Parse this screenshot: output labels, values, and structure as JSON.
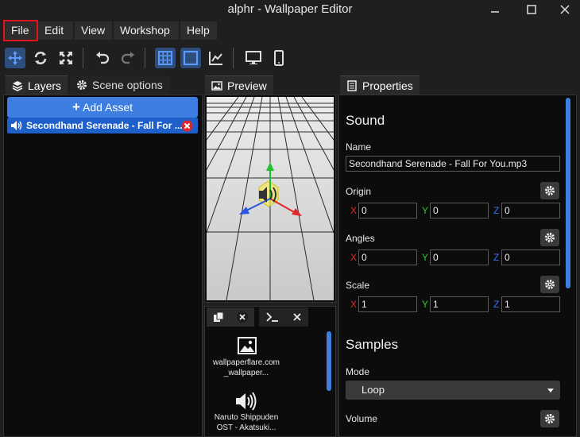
{
  "window": {
    "title": "alphr - Wallpaper Editor"
  },
  "menu": {
    "file": "File",
    "edit": "Edit",
    "view": "View",
    "workshop": "Workshop",
    "help": "Help"
  },
  "left": {
    "tab_layers": "Layers",
    "tab_scene": "Scene options",
    "add_asset": "Add Asset",
    "layer_name": "Secondhand Serenade - Fall For ..."
  },
  "preview": {
    "tab": "Preview"
  },
  "assets": {
    "items": [
      {
        "label1": "wallpaperflare.com",
        "label2": "_wallpaper..."
      },
      {
        "label1": "Naruto Shippuden",
        "label2": "OST - Akatsuki..."
      }
    ]
  },
  "properties": {
    "tab": "Properties",
    "section_sound": "Sound",
    "name_label": "Name",
    "name_value": "Secondhand Serenade - Fall For You.mp3",
    "origin_label": "Origin",
    "origin": {
      "x": "0",
      "y": "0",
      "z": "0"
    },
    "angles_label": "Angles",
    "angles": {
      "x": "0",
      "y": "0",
      "z": "0"
    },
    "scale_label": "Scale",
    "scale": {
      "x": "1",
      "y": "1",
      "z": "1"
    },
    "axis": {
      "x": "X",
      "y": "Y",
      "z": "Z"
    },
    "section_samples": "Samples",
    "mode_label": "Mode",
    "mode_value": "Loop",
    "volume_label": "Volume"
  },
  "colors": {
    "accent": "#3d7ee0",
    "axis_x": "#e0262b",
    "axis_y": "#2ec72e",
    "axis_z": "#3a6ff0",
    "highlight": "#e0141e"
  }
}
